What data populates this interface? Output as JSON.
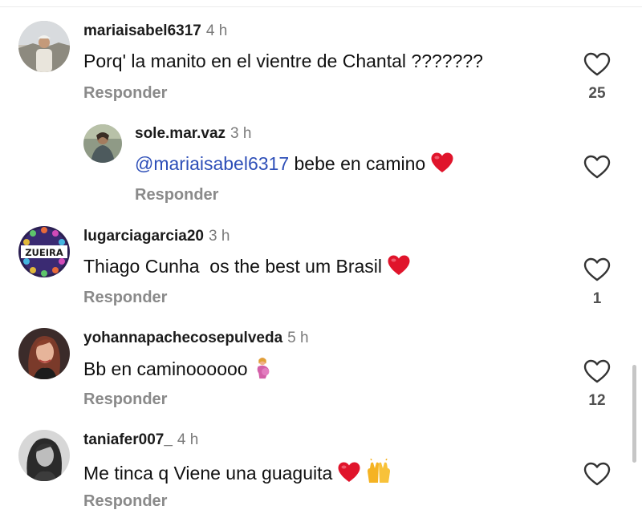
{
  "colors": {
    "mention": "#2e4fb8",
    "heart": "#e0142b",
    "muted": "#8a8a8a"
  },
  "comments": [
    {
      "username": "mariaisabel6317",
      "time": "4 h",
      "text": "Porq' la manito en el vientre de Chantal ???????",
      "reply_label": "Responder",
      "likes": "25",
      "avatar_icon": "avatar-photo-icon"
    },
    {
      "username": "sole.mar.vaz",
      "time": "3 h",
      "mention": "@mariaisabel6317",
      "text": " bebe en camino",
      "emoji": "red-heart-icon",
      "reply_label": "Responder",
      "likes": "",
      "avatar_icon": "avatar-photo-icon"
    },
    {
      "username": "lugarciagarcia20",
      "time": "3 h",
      "text": "Thiago Cunha  os the best um Brasil",
      "emoji": "red-heart-icon",
      "avatar_logo_text": "ZUEIRA",
      "reply_label": "Responder",
      "likes": "1",
      "avatar_icon": "zueira-logo-icon"
    },
    {
      "username": "yohannapachecosepulveda",
      "time": "5 h",
      "text": "Bb en caminoooooo",
      "emoji": "pregnant-woman-icon",
      "reply_label": "Responder",
      "likes": "12",
      "avatar_icon": "avatar-photo-icon"
    },
    {
      "username": "taniafer007_",
      "time": "4 h",
      "text": "Me tinca q Viene una guaguita",
      "emoji": "red-heart-icon",
      "emoji2": "raising-hands-icon",
      "reply_label": "Responder",
      "likes": "",
      "avatar_icon": "avatar-photo-icon"
    }
  ]
}
